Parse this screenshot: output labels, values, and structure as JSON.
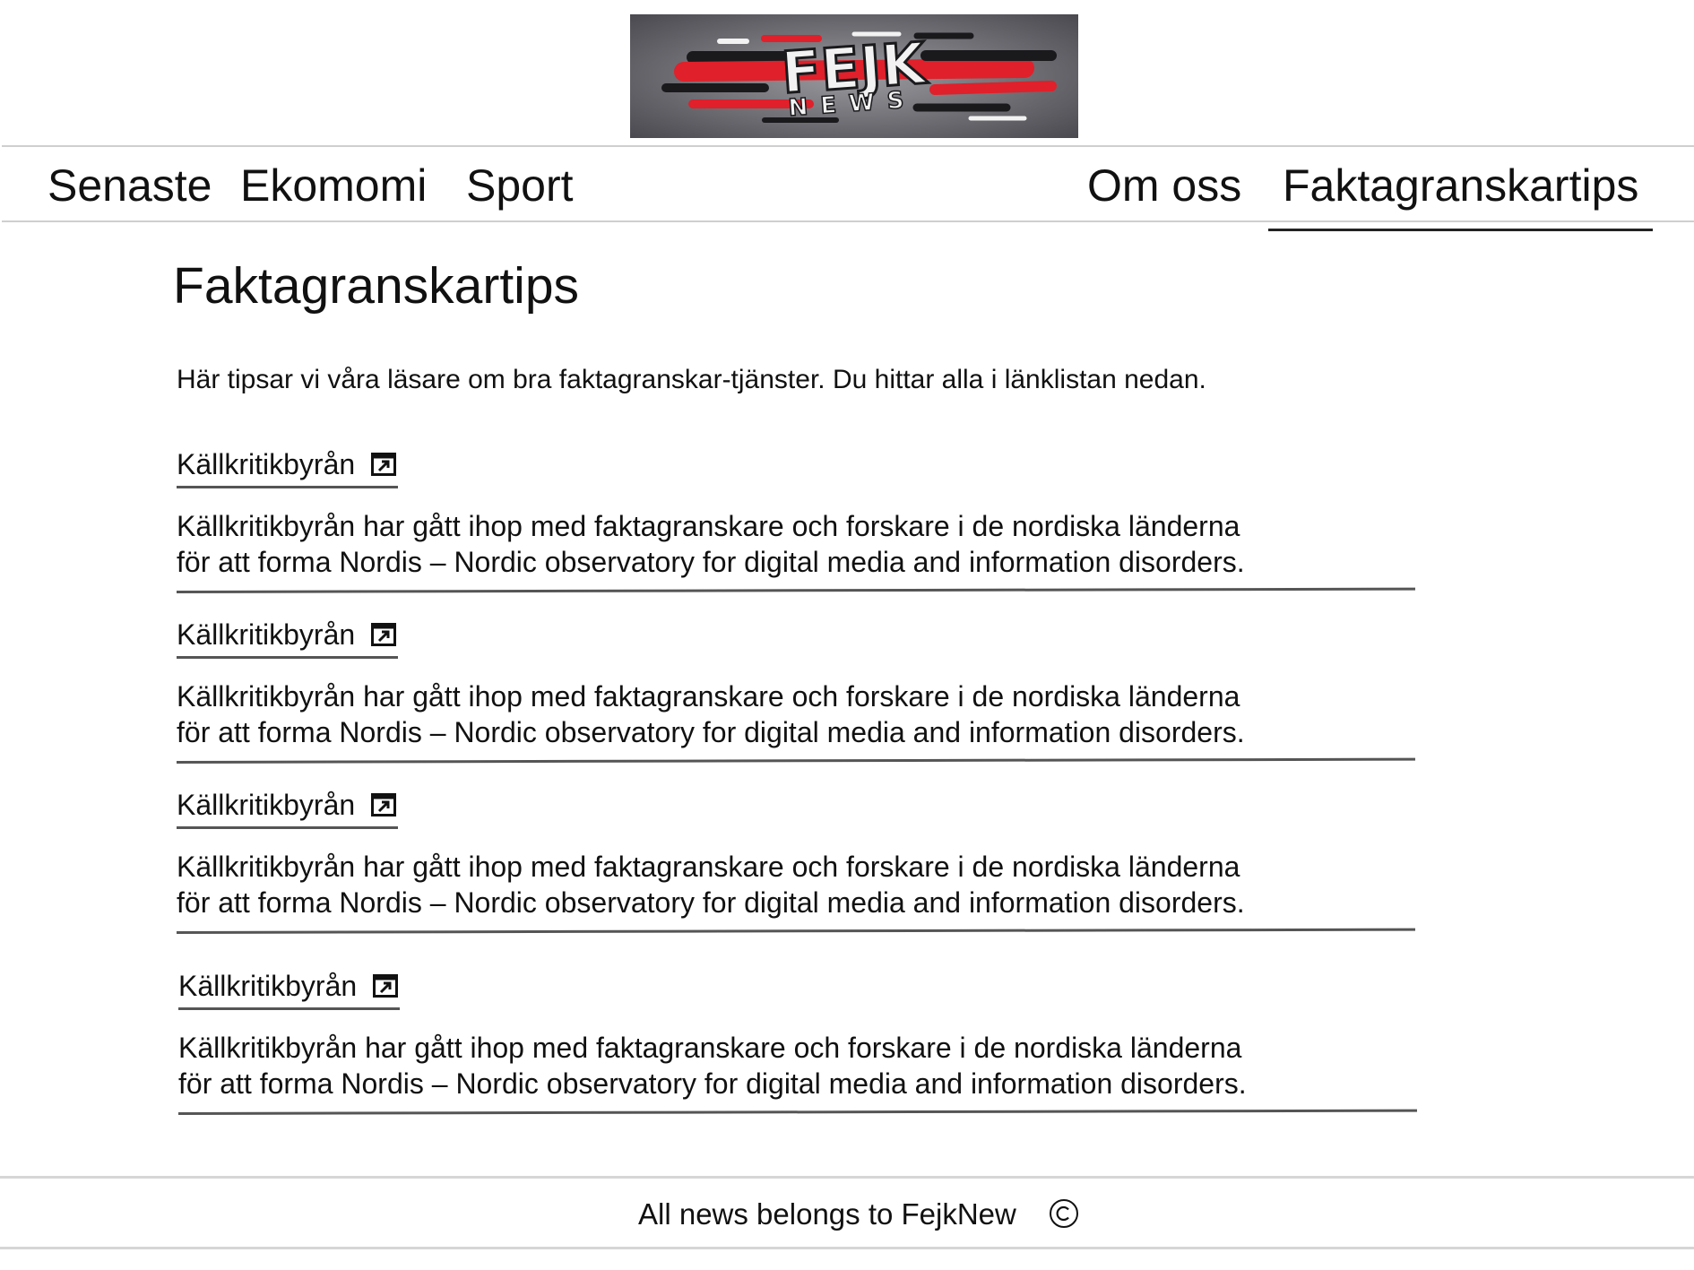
{
  "header": {
    "logo": {
      "alt": "FEJK NEWS",
      "main_text": "FEJK",
      "sub_text": "NEWS",
      "colors": {
        "bg": "#6d6d72",
        "red": "#e0202a",
        "dark": "#1a1a1d",
        "light": "#f2f2f2"
      }
    }
  },
  "nav": {
    "left": [
      "Senaste",
      "Ekomomi",
      "Sport"
    ],
    "right": [
      "Om oss",
      "Faktagranskartips"
    ],
    "active": "Faktagranskartips"
  },
  "main": {
    "title": "Faktagranskartips",
    "intro": "Här tipsar vi våra läsare om bra faktagranskar-tjänster. Du hittar alla i länklistan nedan.",
    "entries": [
      {
        "link": "Källkritikbyrån",
        "icon": "external-link-icon",
        "desc_line1": "Källkritikbyrån har gått ihop med faktagranskare och forskare i de nordiska länderna",
        "desc_line2": "för att forma Nordis – Nordic observatory for digital media and information disorders."
      },
      {
        "link": "Källkritikbyrån",
        "icon": "external-link-icon",
        "desc_line1": "Källkritikbyrån har gått ihop med faktagranskare och forskare i de nordiska länderna",
        "desc_line2": "för att forma Nordis – Nordic observatory for digital media and information disorders."
      },
      {
        "link": "Källkritikbyrån",
        "icon": "external-link-icon",
        "desc_line1": "Källkritikbyrån har gått ihop med faktagranskare och forskare i de nordiska länderna",
        "desc_line2": "för att forma Nordis – Nordic observatory for digital media and information disorders."
      },
      {
        "link": "Källkritikbyrån",
        "icon": "external-link-icon",
        "desc_line1": "Källkritikbyrån har gått ihop med faktagranskare och forskare i de nordiska länderna",
        "desc_line2": "för att forma Nordis – Nordic observatory for digital media and information disorders."
      }
    ]
  },
  "footer": {
    "text": "All news belongs to FejkNew",
    "icon": "copyright-icon"
  }
}
